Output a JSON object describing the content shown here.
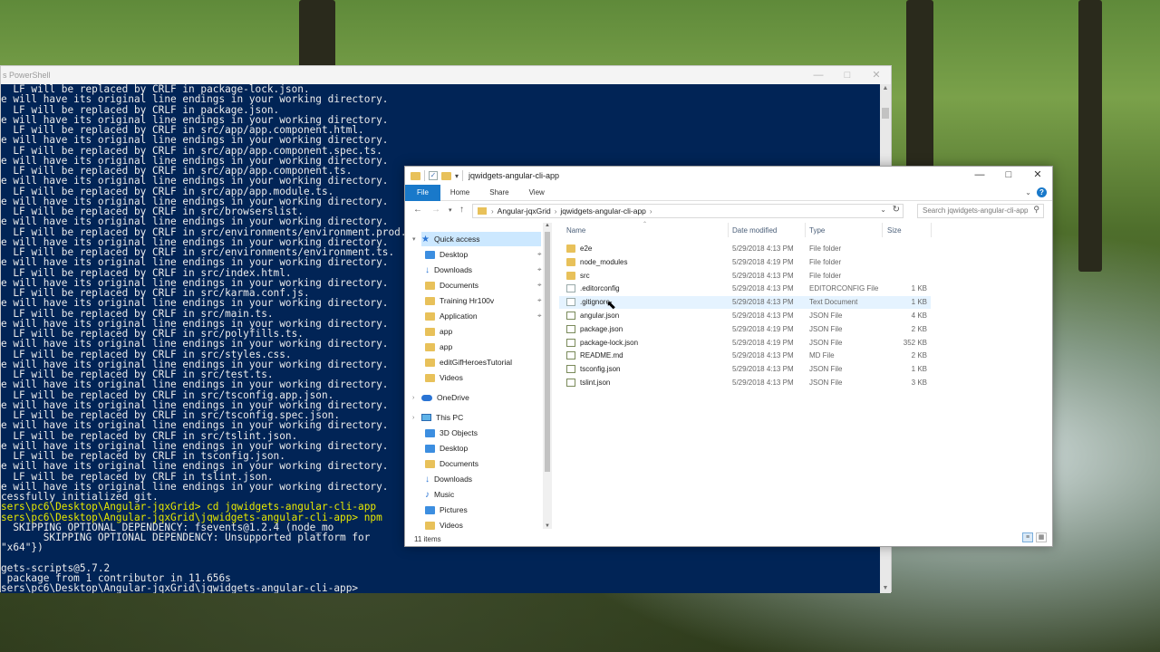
{
  "powershell": {
    "title": "s PowerShell",
    "lines": [
      {
        "text": "  LF will be replaced by CRLF in package-lock.json.",
        "color": "white"
      },
      {
        "text": "e will have its original line endings in your working directory.",
        "color": "white"
      },
      {
        "text": "  LF will be replaced by CRLF in package.json.",
        "color": "white"
      },
      {
        "text": "e will have its original line endings in your working directory.",
        "color": "white"
      },
      {
        "text": "  LF will be replaced by CRLF in src/app/app.component.html.",
        "color": "white"
      },
      {
        "text": "e will have its original line endings in your working directory.",
        "color": "white"
      },
      {
        "text": "  LF will be replaced by CRLF in src/app/app.component.spec.ts.",
        "color": "white"
      },
      {
        "text": "e will have its original line endings in your working directory.",
        "color": "white"
      },
      {
        "text": "  LF will be replaced by CRLF in src/app/app.component.ts.",
        "color": "white"
      },
      {
        "text": "e will have its original line endings in your working directory.",
        "color": "white"
      },
      {
        "text": "  LF will be replaced by CRLF in src/app/app.module.ts.",
        "color": "white"
      },
      {
        "text": "e will have its original line endings in your working directory.",
        "color": "white"
      },
      {
        "text": "  LF will be replaced by CRLF in src/browserslist.",
        "color": "white"
      },
      {
        "text": "e will have its original line endings in your working directory.",
        "color": "white"
      },
      {
        "text": "  LF will be replaced by CRLF in src/environments/environment.prod.ts.",
        "color": "white"
      },
      {
        "text": "e will have its original line endings in your working directory.",
        "color": "white"
      },
      {
        "text": "  LF will be replaced by CRLF in src/environments/environment.ts.",
        "color": "white"
      },
      {
        "text": "e will have its original line endings in your working directory.",
        "color": "white"
      },
      {
        "text": "  LF will be replaced by CRLF in src/index.html.",
        "color": "white"
      },
      {
        "text": "e will have its original line endings in your working directory.",
        "color": "white"
      },
      {
        "text": "  LF will be replaced by CRLF in src/karma.conf.js.",
        "color": "white"
      },
      {
        "text": "e will have its original line endings in your working directory.",
        "color": "white"
      },
      {
        "text": "  LF will be replaced by CRLF in src/main.ts.",
        "color": "white"
      },
      {
        "text": "e will have its original line endings in your working directory.",
        "color": "white"
      },
      {
        "text": "  LF will be replaced by CRLF in src/polyfills.ts.",
        "color": "white"
      },
      {
        "text": "e will have its original line endings in your working directory.",
        "color": "white"
      },
      {
        "text": "  LF will be replaced by CRLF in src/styles.css.",
        "color": "white"
      },
      {
        "text": "e will have its original line endings in your working directory.",
        "color": "white"
      },
      {
        "text": "  LF will be replaced by CRLF in src/test.ts.",
        "color": "white"
      },
      {
        "text": "e will have its original line endings in your working directory.",
        "color": "white"
      },
      {
        "text": "  LF will be replaced by CRLF in src/tsconfig.app.json.",
        "color": "white"
      },
      {
        "text": "e will have its original line endings in your working directory.",
        "color": "white"
      },
      {
        "text": "  LF will be replaced by CRLF in src/tsconfig.spec.json.",
        "color": "white"
      },
      {
        "text": "e will have its original line endings in your working directory.",
        "color": "white"
      },
      {
        "text": "  LF will be replaced by CRLF in src/tslint.json.",
        "color": "white"
      },
      {
        "text": "e will have its original line endings in your working directory.",
        "color": "white"
      },
      {
        "text": "  LF will be replaced by CRLF in tsconfig.json.",
        "color": "white"
      },
      {
        "text": "e will have its original line endings in your working directory.",
        "color": "white"
      },
      {
        "text": "  LF will be replaced by CRLF in tslint.json.",
        "color": "white"
      },
      {
        "text": "e will have its original line endings in your working directory.",
        "color": "white"
      },
      {
        "text": "cessfully initialized git.",
        "color": "white"
      },
      {
        "text": "sers\\pc6\\Desktop\\Angular-jqxGrid> cd jqwidgets-angular-cli-app",
        "color": "yellow"
      },
      {
        "text": "sers\\pc6\\Desktop\\Angular-jqxGrid\\jqwidgets-angular-cli-app> npm",
        "color": "yellow"
      },
      {
        "text": "  SKIPPING OPTIONAL DEPENDENCY: fsevents@1.2.4 (node_mo",
        "color": "white"
      },
      {
        "text": "       SKIPPING OPTIONAL DEPENDENCY: Unsupported platform for",
        "color": "white"
      },
      {
        "text": "\"x64\"})",
        "color": "white"
      },
      {
        "text": "",
        "color": "white"
      },
      {
        "text": "gets-scripts@5.7.2",
        "color": "white"
      },
      {
        "text": " package from 1 contributor in 11.656s",
        "color": "white"
      },
      {
        "text": "sers\\pc6\\Desktop\\Angular-jqxGrid\\jqwidgets-angular-cli-app>",
        "color": "white"
      }
    ]
  },
  "explorer": {
    "title": "jqwidgets-angular-cli-app",
    "ribbon": {
      "file": "File",
      "home": "Home",
      "share": "Share",
      "view": "View"
    },
    "address": {
      "crumbs": [
        "Angular-jqxGrid",
        "jqwidgets-angular-cli-app"
      ]
    },
    "search": {
      "placeholder": "Search jqwidgets-angular-cli-app"
    },
    "nav": [
      {
        "label": "Quick access",
        "icon": "star-icon",
        "level": 0,
        "selected": true,
        "pinned": false
      },
      {
        "label": "Desktop",
        "icon": "desktop-icon",
        "level": 1,
        "pinned": true
      },
      {
        "label": "Downloads",
        "icon": "download-icon",
        "level": 1,
        "pinned": true
      },
      {
        "label": "Documents",
        "icon": "documents-icon",
        "level": 1,
        "pinned": true
      },
      {
        "label": "Training Hr100v",
        "icon": "folder-icon",
        "level": 1,
        "pinned": true
      },
      {
        "label": "Application",
        "icon": "folder-icon",
        "level": 1,
        "pinned": true
      },
      {
        "label": "app",
        "icon": "folder-icon",
        "level": 1,
        "pinned": false
      },
      {
        "label": "app",
        "icon": "folder-icon",
        "level": 1,
        "pinned": false
      },
      {
        "label": "editGifHeroesTutorial",
        "icon": "folder-icon",
        "level": 1,
        "pinned": false
      },
      {
        "label": "Videos",
        "icon": "videos-icon",
        "level": 1,
        "pinned": false
      },
      {
        "label": "OneDrive",
        "icon": "cloud-icon",
        "level": 0,
        "pinned": false
      },
      {
        "label": "This PC",
        "icon": "computer-icon",
        "level": 0,
        "pinned": false
      },
      {
        "label": "3D Objects",
        "icon": "cube-icon",
        "level": 1,
        "pinned": false
      },
      {
        "label": "Desktop",
        "icon": "desktop-icon",
        "level": 1,
        "pinned": false
      },
      {
        "label": "Documents",
        "icon": "documents-icon",
        "level": 1,
        "pinned": false
      },
      {
        "label": "Downloads",
        "icon": "download-icon",
        "level": 1,
        "pinned": false
      },
      {
        "label": "Music",
        "icon": "music-icon",
        "level": 1,
        "pinned": false
      },
      {
        "label": "Pictures",
        "icon": "pictures-icon",
        "level": 1,
        "pinned": false
      },
      {
        "label": "Videos",
        "icon": "videos-icon",
        "level": 1,
        "pinned": false
      }
    ],
    "columns": {
      "name": "Name",
      "date": "Date modified",
      "type": "Type",
      "size": "Size"
    },
    "files": [
      {
        "name": "e2e",
        "date": "5/29/2018 4:13 PM",
        "type": "File folder",
        "size": "",
        "kind": "folder"
      },
      {
        "name": "node_modules",
        "date": "5/29/2018 4:19 PM",
        "type": "File folder",
        "size": "",
        "kind": "folder"
      },
      {
        "name": "src",
        "date": "5/29/2018 4:13 PM",
        "type": "File folder",
        "size": "",
        "kind": "folder"
      },
      {
        "name": ".editorconfig",
        "date": "5/29/2018 4:13 PM",
        "type": "EDITORCONFIG File",
        "size": "1 KB",
        "kind": "doc"
      },
      {
        "name": ".gitignore",
        "date": "5/29/2018 4:13 PM",
        "type": "Text Document",
        "size": "1 KB",
        "kind": "doc",
        "hover": true
      },
      {
        "name": "angular.json",
        "date": "5/29/2018 4:13 PM",
        "type": "JSON File",
        "size": "4 KB",
        "kind": "json"
      },
      {
        "name": "package.json",
        "date": "5/29/2018 4:19 PM",
        "type": "JSON File",
        "size": "2 KB",
        "kind": "json"
      },
      {
        "name": "package-lock.json",
        "date": "5/29/2018 4:19 PM",
        "type": "JSON File",
        "size": "352 KB",
        "kind": "json"
      },
      {
        "name": "README.md",
        "date": "5/29/2018 4:13 PM",
        "type": "MD File",
        "size": "2 KB",
        "kind": "json"
      },
      {
        "name": "tsconfig.json",
        "date": "5/29/2018 4:13 PM",
        "type": "JSON File",
        "size": "1 KB",
        "kind": "json"
      },
      {
        "name": "tslint.json",
        "date": "5/29/2018 4:13 PM",
        "type": "JSON File",
        "size": "3 KB",
        "kind": "json"
      }
    ],
    "status": "11 items"
  },
  "colors": {
    "console_bg": "#012456",
    "console_text": "#ececec",
    "console_prompt": "#e8e800",
    "ribbon_file": "#1979ca",
    "selection": "#cce8ff",
    "hover": "#e5f3ff"
  }
}
